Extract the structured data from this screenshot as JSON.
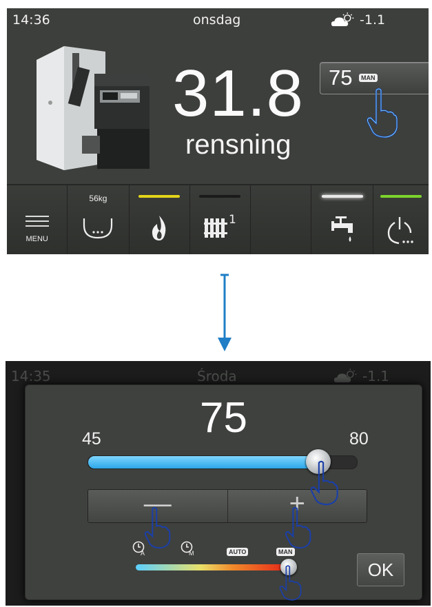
{
  "screen1": {
    "status": {
      "time": "14:36",
      "day": "onsdag",
      "outdoor_temp": "-1.1"
    },
    "main": {
      "temperature": "31.8",
      "mode": "rensning"
    },
    "setpoint": {
      "value": "75",
      "mode_badge": "MAN"
    },
    "bottom_bar": {
      "menu_label": "MENU",
      "fuel_level": "56kg",
      "radiator_circuit": "1",
      "indicator_colors": {
        "flame": "#e2d51a",
        "radiator": "#1a1a1a",
        "tap": "#e8e8e8",
        "power": "#7cd32c"
      }
    }
  },
  "screen2": {
    "status": {
      "time": "14:35",
      "day": "Środa",
      "outdoor_temp": "-1.1"
    },
    "dialog": {
      "value": "75",
      "min": "45",
      "max": "80",
      "slider_value": 75,
      "slider_min": 45,
      "slider_max": 80,
      "minus_label": "—",
      "plus_label": "+",
      "modes": {
        "clock_a_sub": "A",
        "clock_m_sub": "M",
        "auto": "AUTO",
        "man": "MAN"
      },
      "mode_slider_position": 0.95,
      "ok_label": "OK"
    }
  },
  "colors": {
    "accent_blue": "#2ca6e8",
    "arrow_blue": "#1f7ec6",
    "hand_outline": "#1a3fa8"
  }
}
